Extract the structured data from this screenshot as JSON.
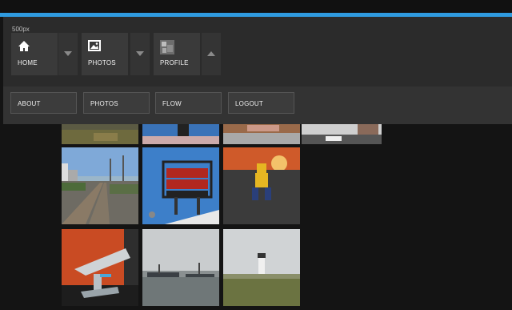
{
  "app": {
    "name": "500px"
  },
  "nav": {
    "home_label": "HOME",
    "photos_label": "PHOTOS",
    "profile_label": "PROFILE"
  },
  "subnav": {
    "about_label": "ABOUT",
    "photos_label": "PHOTOS",
    "flow_label": "FLOW",
    "logout_label": "LOGOUT"
  },
  "colors": {
    "accent": "#2f9be0",
    "nav_bg": "#2b2b2b",
    "tile_bg": "#3a3a3a"
  },
  "icons": {
    "home": "home-icon",
    "photos": "image-icon",
    "profile": "avatar-thumbnail"
  },
  "photos": [
    {
      "id": "photo-1"
    },
    {
      "id": "photo-2"
    },
    {
      "id": "photo-3"
    },
    {
      "id": "photo-4"
    },
    {
      "id": "photo-railroad-tracks"
    },
    {
      "id": "photo-public-market-sign"
    },
    {
      "id": "photo-wolverine-figure"
    },
    {
      "id": "photo-toy-ship"
    },
    {
      "id": "photo-harbor-boats"
    },
    {
      "id": "photo-lighthouse"
    }
  ]
}
